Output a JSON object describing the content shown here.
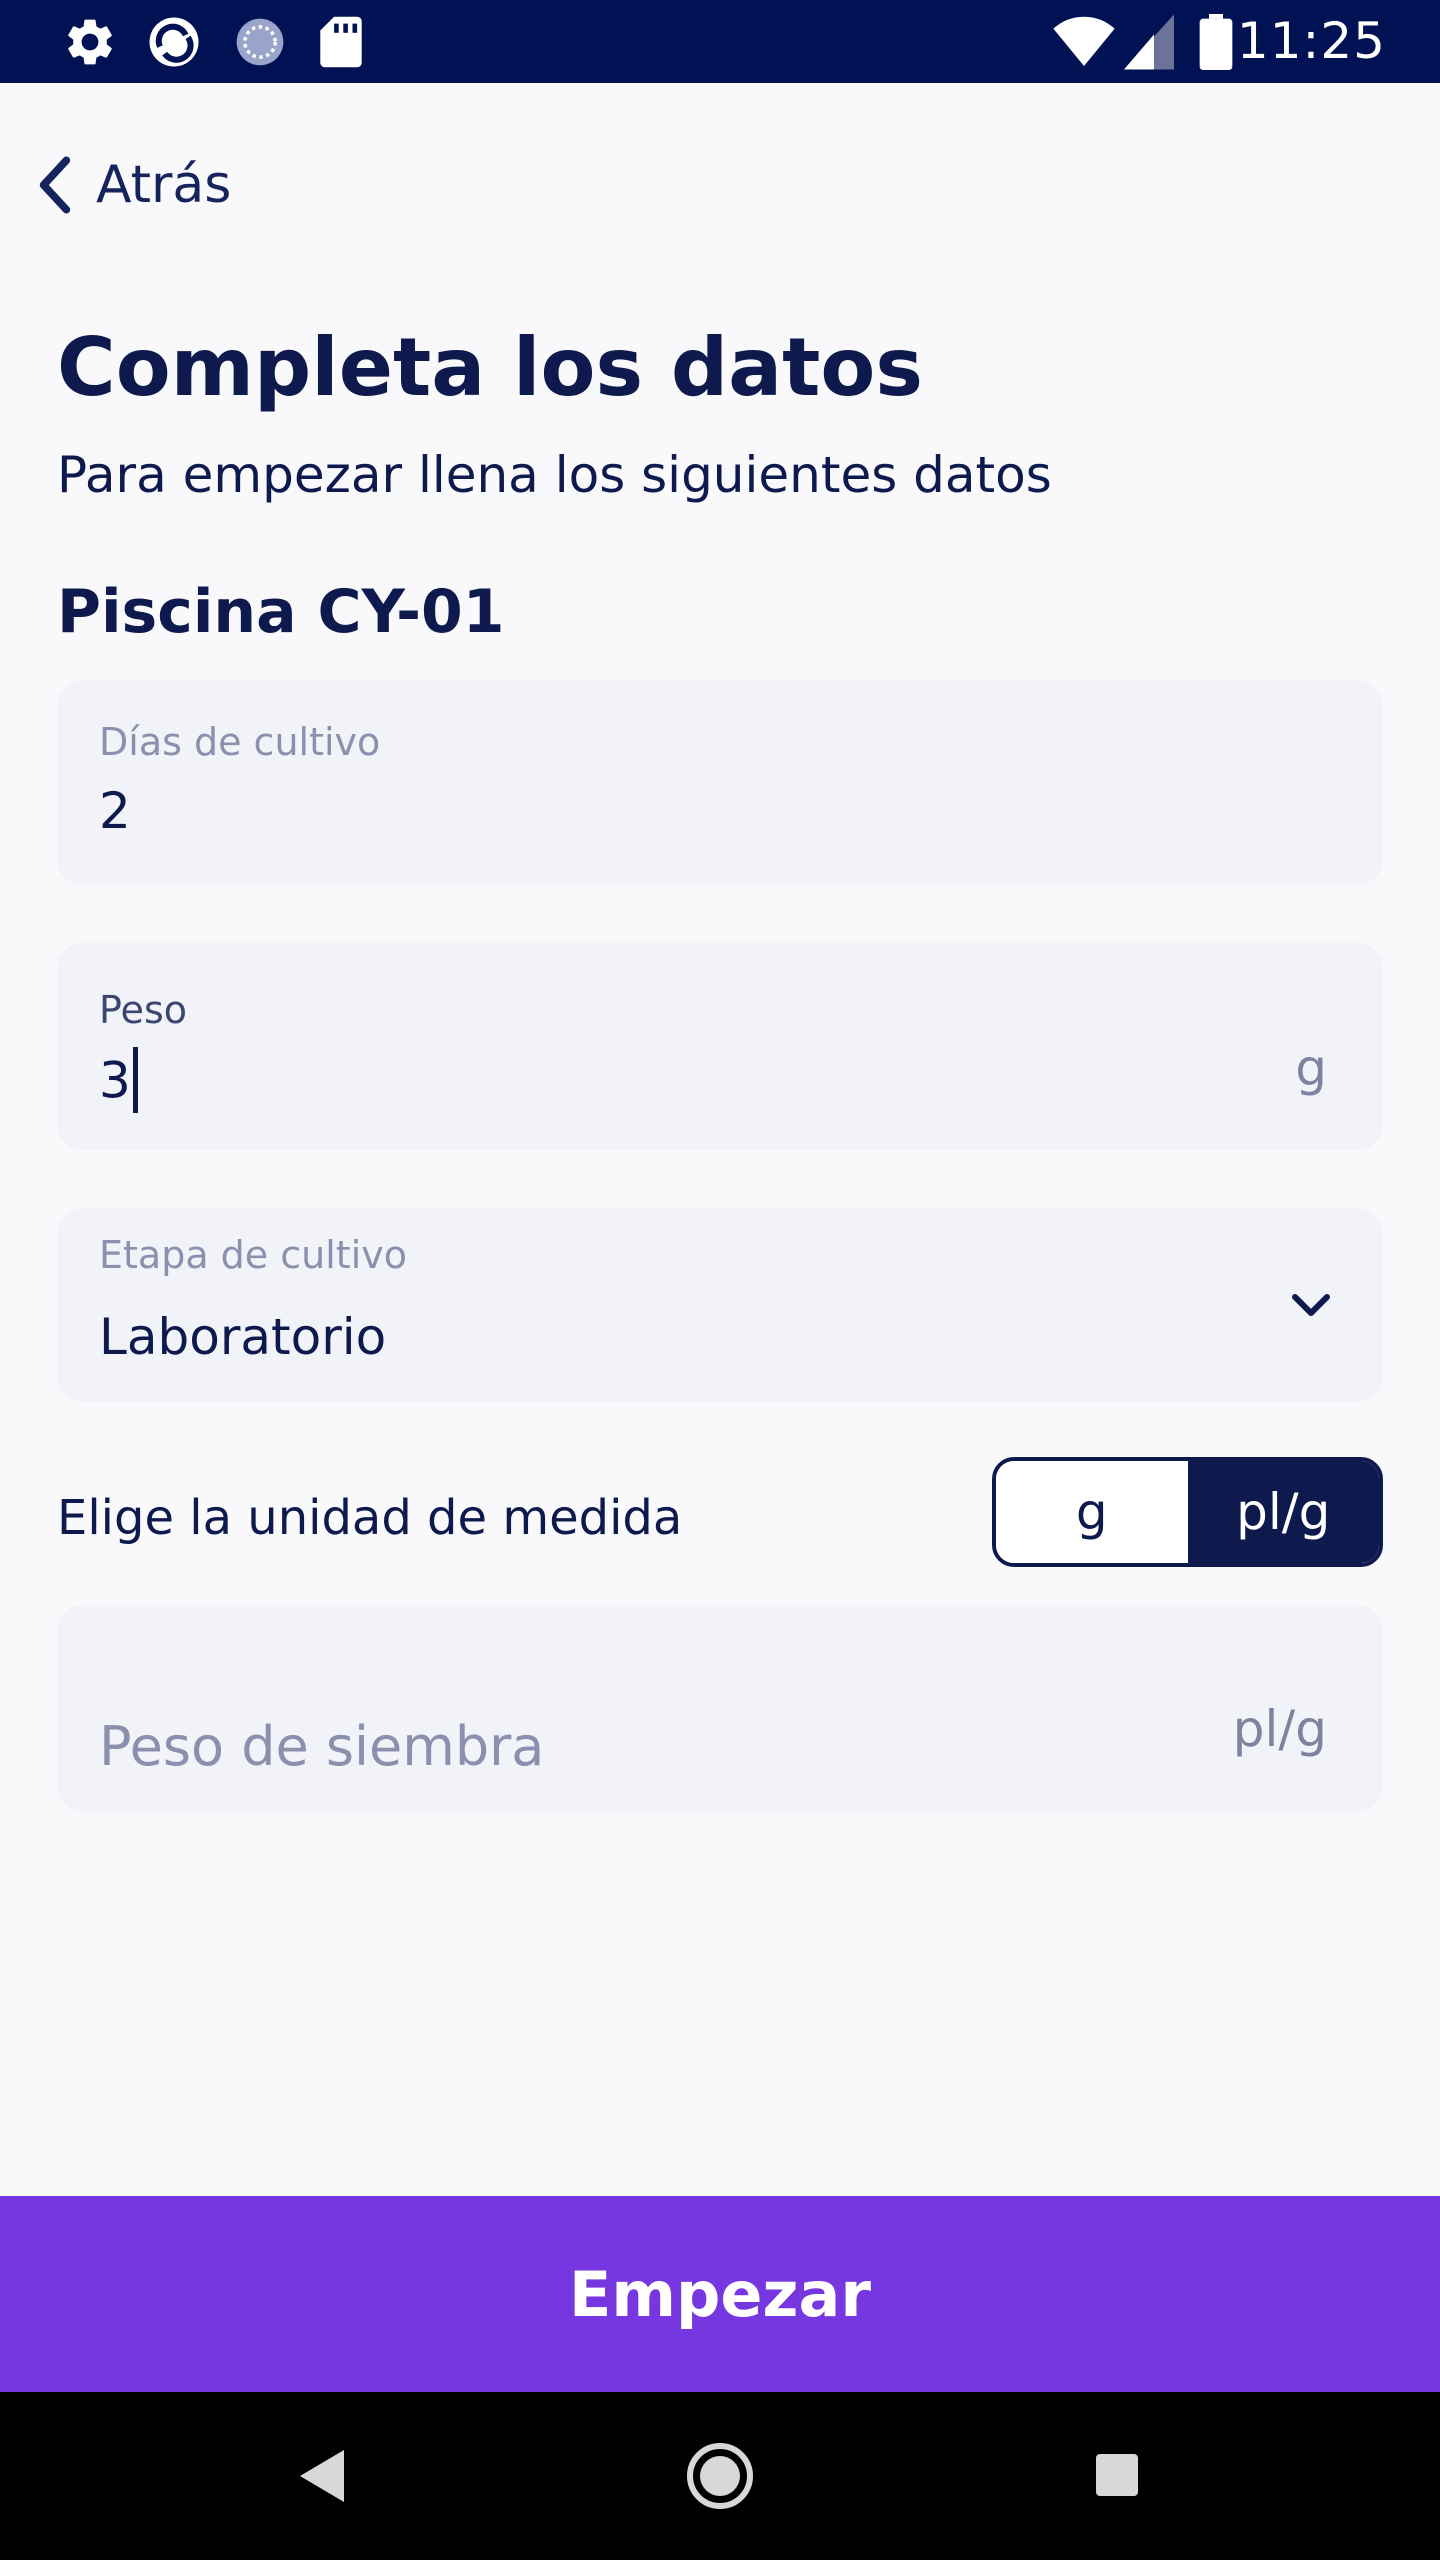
{
  "status_bar": {
    "time": "11:25",
    "icons": [
      "gear-icon",
      "app-logo-icon",
      "sync-icon",
      "sd-card-icon",
      "wifi-icon",
      "signal-icon",
      "battery-icon"
    ]
  },
  "header": {
    "back_label": "Atrás"
  },
  "page": {
    "title": "Completa los datos",
    "subtitle": "Para empezar llena los siguientes datos",
    "section_title": "Piscina CY-01"
  },
  "form": {
    "days": {
      "label": "Días de cultivo",
      "value": "2"
    },
    "weight": {
      "label": "Peso",
      "value": "3",
      "unit": "g"
    },
    "stage": {
      "label": "Etapa de cultivo",
      "value": "Laboratorio"
    },
    "unit_choice": {
      "label": "Elige la unidad de medida",
      "options": [
        "g",
        "pl/g"
      ],
      "selected": "pl/g"
    },
    "seed_weight": {
      "placeholder": "Peso de siembra",
      "unit": "pl/g"
    }
  },
  "actions": {
    "start_label": "Empezar"
  },
  "colors": {
    "status_bar": "#001254",
    "primary_text": "#0e1a4d",
    "field_bg": "#f2f3f9",
    "accent": "#7636e0"
  },
  "nav_bar": {
    "icons": [
      "back-triangle-icon",
      "home-circle-icon",
      "recents-square-icon"
    ]
  }
}
